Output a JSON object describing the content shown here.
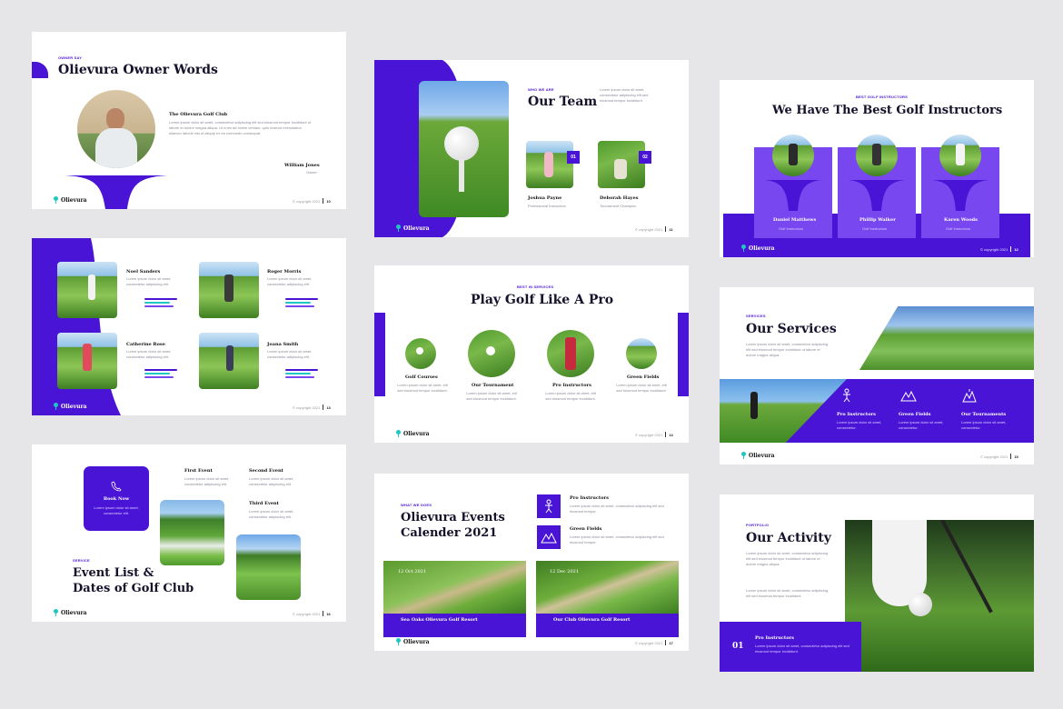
{
  "brand": "Olievura",
  "copyright": "© copyright 2021",
  "slides": {
    "s10": {
      "kicker": "OWNER SAY",
      "title": "Olievura Owner Words",
      "subtitle": "The Olievura Golf Club",
      "body": "Lorem ipsum dolor sit amet, consectetur adipiscing elit sed eiusmod tempor incididunt ut labore et dolore magna aliqua. Ut enim ad minim veniam, quis nostrud exercitation ullamco laboris nisi ut aliquip ex ea commodo consequat.",
      "owner_name": "William Jones",
      "owner_role": "Owner",
      "page": "10"
    },
    "s11": {
      "kicker": "WHO WE ARE",
      "title": "Our Team",
      "body": "Lorem ipsum dolor sit amet, consectetur adipiscing elit sed eiusmod tempor incididunt.",
      "members": [
        {
          "num": "01",
          "name": "Joshua Payne",
          "role": "Professional Instructors"
        },
        {
          "num": "02",
          "name": "Deborah Hayes",
          "role": "Tournament Champion"
        }
      ],
      "page": "11"
    },
    "s12": {
      "kicker": "BEST GOLF INSTRUCTORS",
      "title": "We Have The Best Golf Instructors",
      "instructors": [
        {
          "name": "Daniel Matthews",
          "role": "Golf Instructors"
        },
        {
          "name": "Phillip Walker",
          "role": "Golf Instructors"
        },
        {
          "name": "Karen Woods",
          "role": "Golf Instructors"
        }
      ],
      "page": "12"
    },
    "s13": {
      "players": [
        {
          "name": "Noel Sanders",
          "desc": "Lorem ipsum dolor sit amet, consectetur adipiscing elit."
        },
        {
          "name": "Roger Morris",
          "desc": "Lorem ipsum dolor sit amet, consectetur adipiscing elit."
        },
        {
          "name": "Catherine Rose",
          "desc": "Lorem ipsum dolor sit amet, consectetur adipiscing elit."
        },
        {
          "name": "Joana Smith",
          "desc": "Lorem ipsum dolor sit amet, consectetur adipiscing elit."
        }
      ],
      "page": "13"
    },
    "s14": {
      "kicker": "BEST IN SERVICES",
      "title": "Play Golf Like A Pro",
      "items": [
        {
          "label": "Golf Courses",
          "desc": "Lorem ipsum dolor sit amet, elit sed eiusmod tempor incididunt."
        },
        {
          "label": "Our Tournament",
          "desc": "Lorem ipsum dolor sit amet, elit sed eiusmod tempor incididunt."
        },
        {
          "label": "Pro Instructors",
          "desc": "Lorem ipsum dolor sit amet, elit sed eiusmod tempor incididunt."
        },
        {
          "label": "Green Fields",
          "desc": "Lorem ipsum dolor sit amet, elit sed eiusmod tempor incididunt."
        }
      ],
      "page": "14"
    },
    "s15": {
      "kicker": "SERVICES",
      "title": "Our Services",
      "body": "Lorem ipsum dolor sit amet, consectetur adipiscing elit sed eiusmod tempor incididunt ut labore et dolore magna aliqua.",
      "services": [
        {
          "label": "Pro Instructors",
          "desc": "Lorem ipsum dolor sit amet, consectetur."
        },
        {
          "label": "Green Fields",
          "desc": "Lorem ipsum dolor sit amet, consectetur."
        },
        {
          "label": "Our Tournaments",
          "desc": "Lorem ipsum dolor sit amet, consectetur."
        }
      ],
      "page": "15"
    },
    "s16": {
      "book_label": "Book Now",
      "book_desc": "Lorem ipsum dolor sit amet, consectetur elit.",
      "events": [
        {
          "label": "First Event",
          "desc": "Lorem ipsum dolor sit amet, consectetur adipiscing elit."
        },
        {
          "label": "Second Event",
          "desc": "Lorem ipsum dolor sit amet, consectetur adipiscing elit."
        },
        {
          "label": "Third Event",
          "desc": "Lorem ipsum dolor sit amet, consectetur adipiscing elit."
        }
      ],
      "kicker": "SERVICE",
      "title_line1": "Event List &",
      "title_line2": "Dates of Golf Club",
      "page": "16"
    },
    "s17": {
      "kicker": "WHAT WE DOES",
      "title_line1": "Olievura Events",
      "title_line2": "Calender 2021",
      "features": [
        {
          "label": "Pro Instructors",
          "desc": "Lorem ipsum dolor sit amet, consectetur adipiscing elit sed eiusmod tempor."
        },
        {
          "label": "Green Fields",
          "desc": "Lorem ipsum dolor sit amet, consectetur adipiscing elit sed eiusmod tempor."
        }
      ],
      "cards": [
        {
          "date": "12 Oct 2021",
          "caption": "Sea Oaks Olievura Golf Resort"
        },
        {
          "date": "12 Dec 2021",
          "caption": "Our Club Olievura Golf Resort"
        }
      ],
      "page": "17"
    },
    "s18": {
      "kicker": "PORTFOLIO",
      "title": "Our Activity",
      "body1": "Lorem ipsum dolor sit amet, consectetur adipiscing elit sed eiusmod tempor incididunt ut labore et dolore magna aliqua.",
      "body2": "Lorem ipsum dolor sit amet, consectetur adipiscing elit sed eiusmod tempor incididunt.",
      "num": "01",
      "feature_label": "Pro Instructors",
      "feature_desc": "Lorem ipsum dolor sit amet, consectetur adipiscing elit sed eiusmod tempor incididunt."
    }
  }
}
